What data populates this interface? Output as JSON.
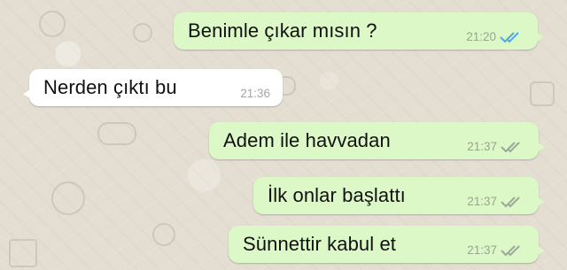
{
  "colors": {
    "wallpaper": "#e3ded1",
    "outgoing_bubble": "#dcf8c6",
    "incoming_bubble": "#ffffff",
    "read_tick": "#4fa9e6",
    "delivered_tick": "#9ba89a"
  },
  "messages": [
    {
      "direction": "outgoing",
      "text": "Benimle çıkar mısın ?",
      "time": "21:20",
      "status_icon": "double-check-read-icon"
    },
    {
      "direction": "incoming",
      "text": "Nerden çıktı bu",
      "time": "21:36"
    },
    {
      "direction": "outgoing",
      "text": "Adem ile havvadan",
      "time": "21:37",
      "status_icon": "double-check-delivered-icon"
    },
    {
      "direction": "outgoing",
      "text": "İlk onlar başlattı",
      "time": "21:37",
      "status_icon": "double-check-delivered-icon"
    },
    {
      "direction": "outgoing",
      "text": "Sünnettir kabul et",
      "time": "21:37",
      "status_icon": "double-check-delivered-icon"
    }
  ]
}
